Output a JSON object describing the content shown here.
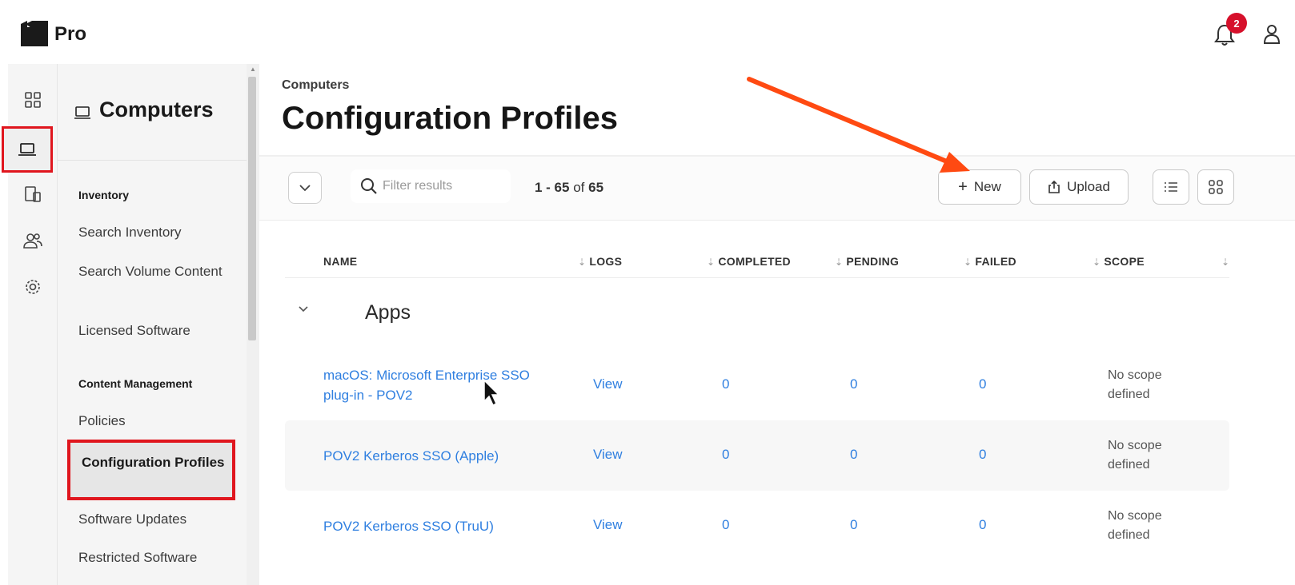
{
  "topbar": {
    "brand": "Pro",
    "notification_count": "2"
  },
  "sidebar": {
    "rail_items": [
      "dashboard-icon",
      "computer-icon",
      "devices-icon",
      "users-icon",
      "settings-icon"
    ],
    "title": "Computers",
    "sections": [
      {
        "label": "Inventory",
        "items": [
          "Search Inventory",
          "Search Volume Content",
          "Licensed Software"
        ]
      },
      {
        "label": "Content Management",
        "items": [
          "Policies",
          "Configuration Profiles",
          "Software Updates",
          "Restricted Software"
        ]
      }
    ],
    "active_item": "Configuration Profiles"
  },
  "main": {
    "breadcrumb": "Computers",
    "title": "Configuration Profiles",
    "filter_placeholder": "Filter results",
    "count": {
      "range": "1 - 65",
      "of": "of",
      "total": "65"
    },
    "new_label": "New",
    "upload_label": "Upload",
    "columns": [
      "NAME",
      "LOGS",
      "COMPLETED",
      "PENDING",
      "FAILED",
      "SCOPE"
    ],
    "group": "Apps",
    "rows": [
      {
        "name": "macOS: Microsoft Enterprise SSO plug-in - POV2",
        "logs": "View",
        "completed": "0",
        "pending": "0",
        "failed": "0",
        "scope": "No scope defined"
      },
      {
        "name": "POV2 Kerberos SSO (Apple)",
        "logs": "View",
        "completed": "0",
        "pending": "0",
        "failed": "0",
        "scope": "No scope defined"
      },
      {
        "name": "POV2 Kerberos SSO (TruU)",
        "logs": "View",
        "completed": "0",
        "pending": "0",
        "failed": "0",
        "scope": "No scope defined"
      }
    ]
  },
  "colors": {
    "accent_link": "#2f7fe0",
    "highlight_red": "#e0161e",
    "annotation_arrow": "#ff4a12",
    "badge": "#d6102b"
  }
}
